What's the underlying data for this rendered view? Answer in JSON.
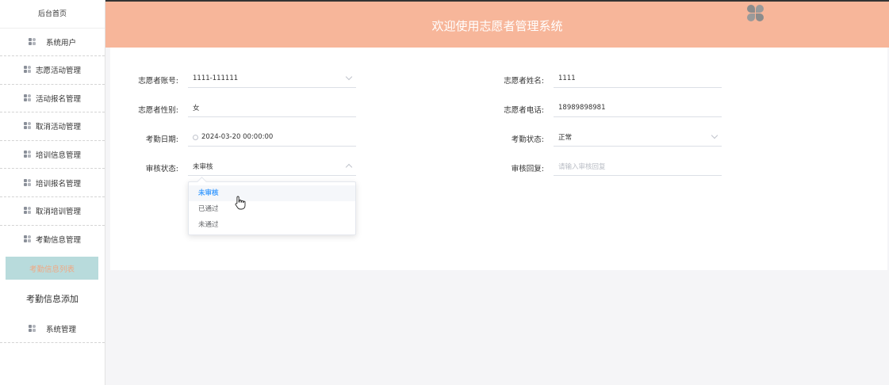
{
  "header": {
    "title": "欢迎使用志愿者管理系统"
  },
  "sidebar": {
    "home": "后台首页",
    "items": [
      {
        "label": "系统用户"
      },
      {
        "label": "志愿活动管理"
      },
      {
        "label": "活动报名管理"
      },
      {
        "label": "取消活动管理"
      },
      {
        "label": "培训信息管理"
      },
      {
        "label": "培训报名管理"
      },
      {
        "label": "取消培训管理"
      },
      {
        "label": "考勤信息管理"
      }
    ],
    "active_sub": "考勤信息列表",
    "sub_add": "考勤信息添加",
    "last_item": "系统管理"
  },
  "form": {
    "account_label": "志愿者账号:",
    "account_value": "1111-111111",
    "name_label": "志愿者姓名:",
    "name_value": "1111",
    "gender_label": "志愿者性别:",
    "gender_value": "女",
    "phone_label": "志愿者电话:",
    "phone_value": "18989898981",
    "date_label": "考勤日期:",
    "date_value": "2024-03-20 00:00:00",
    "status_label": "考勤状态:",
    "status_value": "正常",
    "audit_label": "审核状态:",
    "audit_value": "未审核",
    "reply_label": "审核回复:",
    "reply_placeholder": "请输入审核回复"
  },
  "dropdown": {
    "options": [
      "未审核",
      "已通过",
      "未通过"
    ],
    "selected": "未审核"
  }
}
